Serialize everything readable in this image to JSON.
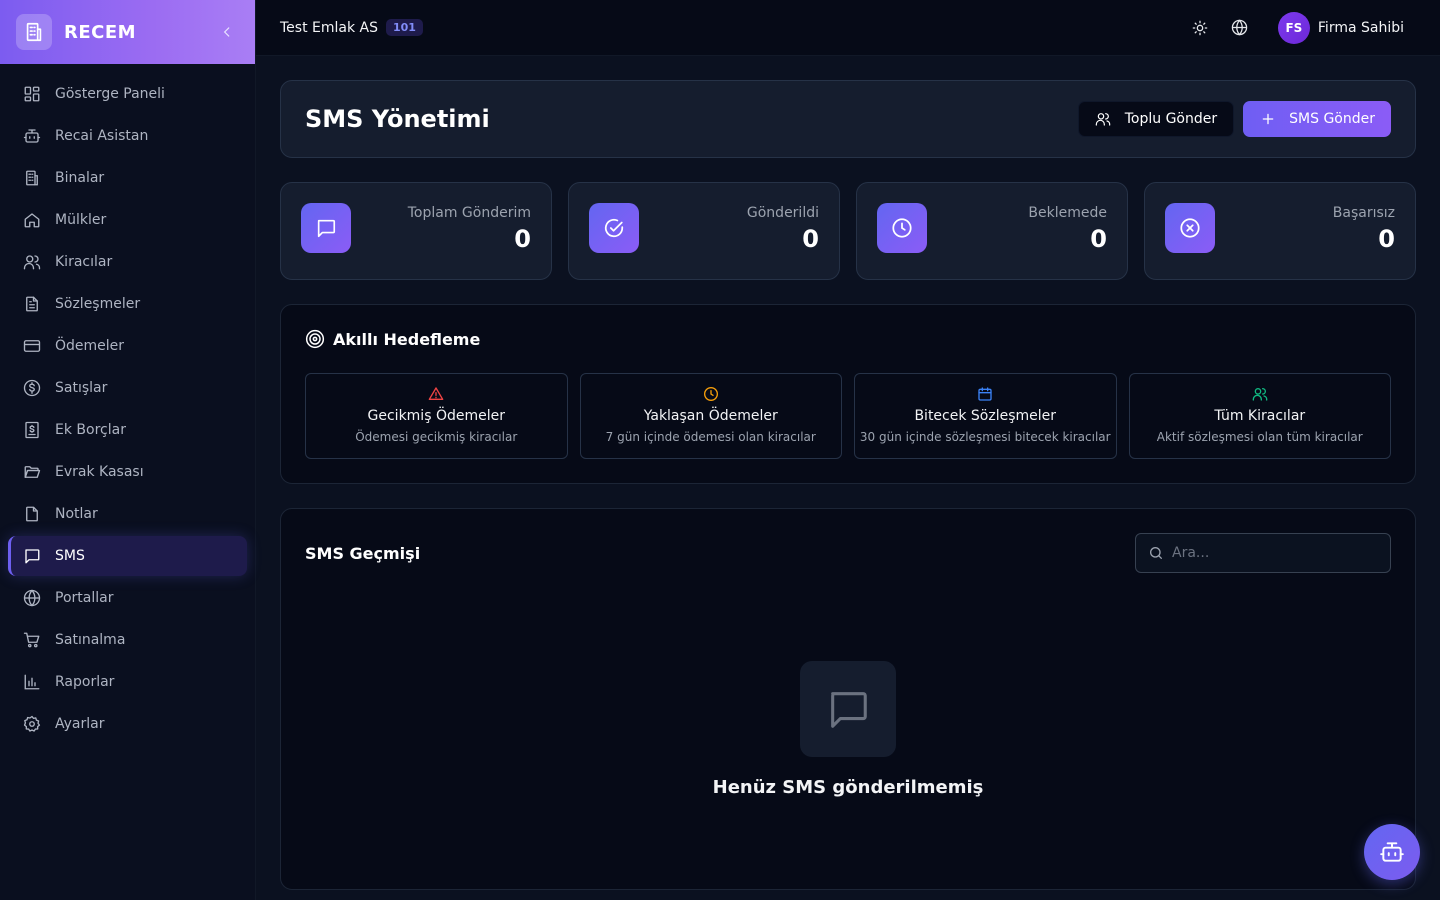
{
  "app": {
    "brand": "RECEM"
  },
  "sidebar": {
    "items": [
      {
        "label": "Gösterge Paneli",
        "icon": "dashboard-icon"
      },
      {
        "label": "Recai Asistan",
        "icon": "bot-icon"
      },
      {
        "label": "Binalar",
        "icon": "building-icon"
      },
      {
        "label": "Mülkler",
        "icon": "home-icon"
      },
      {
        "label": "Kiracılar",
        "icon": "users-icon"
      },
      {
        "label": "Sözleşmeler",
        "icon": "contract-icon"
      },
      {
        "label": "Ödemeler",
        "icon": "credit-card-icon"
      },
      {
        "label": "Satışlar",
        "icon": "dollar-icon"
      },
      {
        "label": "Ek Borçlar",
        "icon": "receipt-icon"
      },
      {
        "label": "Evrak Kasası",
        "icon": "folder-icon"
      },
      {
        "label": "Notlar",
        "icon": "note-icon"
      },
      {
        "label": "SMS",
        "icon": "message-icon",
        "active": true
      },
      {
        "label": "Portallar",
        "icon": "globe-icon"
      },
      {
        "label": "Satınalma",
        "icon": "cart-icon"
      },
      {
        "label": "Raporlar",
        "icon": "chart-icon"
      },
      {
        "label": "Ayarlar",
        "icon": "gear-icon"
      }
    ]
  },
  "topbar": {
    "company": "Test Emlak AS",
    "company_code": "101",
    "user_initials": "FS",
    "user_name": "Firma Sahibi"
  },
  "page": {
    "title": "SMS Yönetimi",
    "bulk_send_label": "Toplu Gönder",
    "send_sms_label": "SMS Gönder"
  },
  "stats": [
    {
      "label": "Toplam Gönderim",
      "value": "0",
      "icon": "message-icon"
    },
    {
      "label": "Gönderildi",
      "value": "0",
      "icon": "check-circle-icon"
    },
    {
      "label": "Beklemede",
      "value": "0",
      "icon": "clock-icon"
    },
    {
      "label": "Başarısız",
      "value": "0",
      "icon": "x-circle-icon"
    }
  ],
  "targeting": {
    "title": "Akıllı Hedefleme",
    "items": [
      {
        "title": "Gecikmiş Ödemeler",
        "desc": "Ödemesi gecikmiş kiracılar",
        "icon": "warning-icon",
        "color": "#ef4444"
      },
      {
        "title": "Yaklaşan Ödemeler",
        "desc": "7 gün içinde ödemesi olan kiracılar",
        "icon": "clock-icon",
        "color": "#f59e0b"
      },
      {
        "title": "Bitecek Sözleşmeler",
        "desc": "30 gün içinde sözleşmesi bitecek kiracılar",
        "icon": "calendar-icon",
        "color": "#3b82f6"
      },
      {
        "title": "Tüm Kiracılar",
        "desc": "Aktif sözleşmesi olan tüm kiracılar",
        "icon": "users-icon",
        "color": "#10b981"
      }
    ]
  },
  "history": {
    "title": "SMS Geçmişi",
    "search_placeholder": "Ara...",
    "empty_text": "Henüz SMS gönderilmemiş"
  },
  "colors": {
    "accent": "#6366f1",
    "brand_gradient_start": "#7c5cf0",
    "brand_gradient_end": "#a97ef5"
  }
}
